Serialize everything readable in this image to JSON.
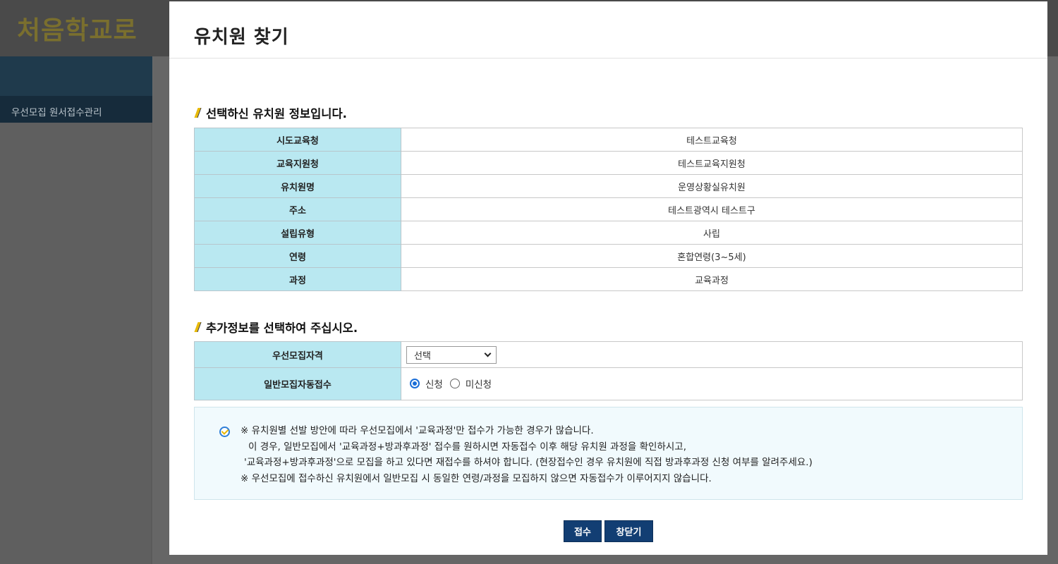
{
  "app": {
    "logo_text": "처음학교로",
    "sidebar_item": "우선모집 원서접수관리"
  },
  "modal": {
    "title": "유치원 찾기",
    "section1_title": "선택하신 유치원 정보입니다.",
    "info_rows": [
      {
        "label": "시도교육청",
        "value": "테스트교육청"
      },
      {
        "label": "교육지원청",
        "value": "테스트교육지원청"
      },
      {
        "label": "유치원명",
        "value": "운영상황실유치원"
      },
      {
        "label": "주소",
        "value": "테스트광역시 테스트구"
      },
      {
        "label": "설립유형",
        "value": "사립"
      },
      {
        "label": "연령",
        "value": "혼합연령(3~5세)"
      },
      {
        "label": "과정",
        "value": "교육과정"
      }
    ],
    "section2_title": "추가정보를 선택하여 주십시오.",
    "priority_label": "우선모집자격",
    "priority_select_value": "선택",
    "auto_label": "일반모집자동접수",
    "radio_apply": "신청",
    "radio_not_apply": "미신청",
    "radio_selected": "신청",
    "notice_lines": [
      "※ 유치원별 선발 방안에 따라 우선모집에서 '교육과정'만 접수가 가능한 경우가 많습니다.",
      "이 경우, 일반모집에서 '교육과정+방과후과정' 접수를 원하시면 자동접수 이후 해당 유치원 과정을 확인하시고,",
      "'교육과정+방과후과정'으로 모집을 하고 있다면 재접수를 하셔야 합니다. (현장접수인 경우 유치원에 직접 방과후과정 신청 여부를 알려주세요.)",
      "※ 우선모집에 접수하신 유치원에서 일반모집 시 동일한 연령/과정을 모집하지 않으면 자동접수가 이루어지지 않습니다."
    ],
    "submit_label": "접수",
    "close_label": "창닫기"
  },
  "colors": {
    "header_cell": "#b9e8f1",
    "button": "#123e73",
    "accent_slash": "#e7b700",
    "radio_selected": "#1a6ed8"
  }
}
